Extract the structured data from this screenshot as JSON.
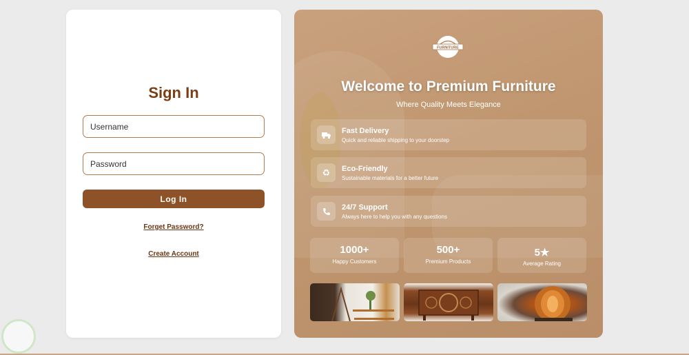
{
  "login": {
    "title": "Sign In",
    "username_placeholder": "Username",
    "password_placeholder": "Password",
    "login_label": "Log In",
    "forgot_label": "Forget Password?",
    "create_label": "Create Account"
  },
  "promo": {
    "logo_text": "FURNITURE",
    "title": "Welcome to Premium Furniture",
    "tagline": "Where Quality Meets Elegance",
    "features": [
      {
        "icon": "truck-icon",
        "title": "Fast Delivery",
        "description": "Quick and reliable shipping to your doorstep"
      },
      {
        "icon": "recycle-icon",
        "title": "Eco-Friendly",
        "description": "Sustainable materials for a better future"
      },
      {
        "icon": "phone-icon",
        "title": "24/7 Support",
        "description": "Always here to help you with any questions"
      }
    ],
    "stats": [
      {
        "value": "1000+",
        "label": "Happy Customers"
      },
      {
        "value": "500+",
        "label": "Premium Products"
      },
      {
        "value": "5★",
        "label": "Average Rating"
      }
    ],
    "photos": [
      "shelf-photo",
      "cabinet-photo",
      "wood-lamp-photo"
    ]
  },
  "colors": {
    "accent": "#8e5228",
    "title": "#7a3e14",
    "panel": "#c9a17d"
  }
}
